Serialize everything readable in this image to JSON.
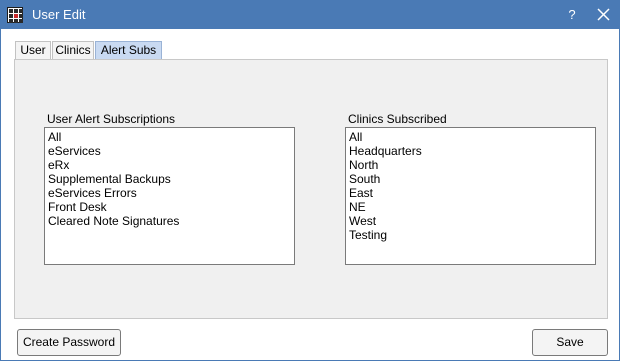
{
  "window": {
    "title": "User Edit",
    "help_label": "?",
    "icons": {
      "app": "grid-app-icon",
      "close": "close-icon"
    }
  },
  "tabs": [
    {
      "label": "User",
      "active": false
    },
    {
      "label": "Clinics",
      "active": false
    },
    {
      "label": "Alert Subs",
      "active": true
    }
  ],
  "alert_subs": {
    "user_alerts": {
      "label": "User Alert Subscriptions",
      "items": [
        "All",
        "eServices",
        "eRx",
        "Supplemental Backups",
        "eServices Errors",
        "Front Desk",
        "Cleared Note Signatures"
      ]
    },
    "clinics": {
      "label": "Clinics Subscribed",
      "items": [
        "All",
        "Headquarters",
        "North",
        "South",
        "East",
        "NE",
        "West",
        "Testing"
      ]
    }
  },
  "footer": {
    "create_password_label": "Create Password",
    "save_label": "Save"
  },
  "colors": {
    "titlebar": "#4a7ab5",
    "active_tab": "#c9daf2",
    "panel": "#f0f0f0"
  }
}
